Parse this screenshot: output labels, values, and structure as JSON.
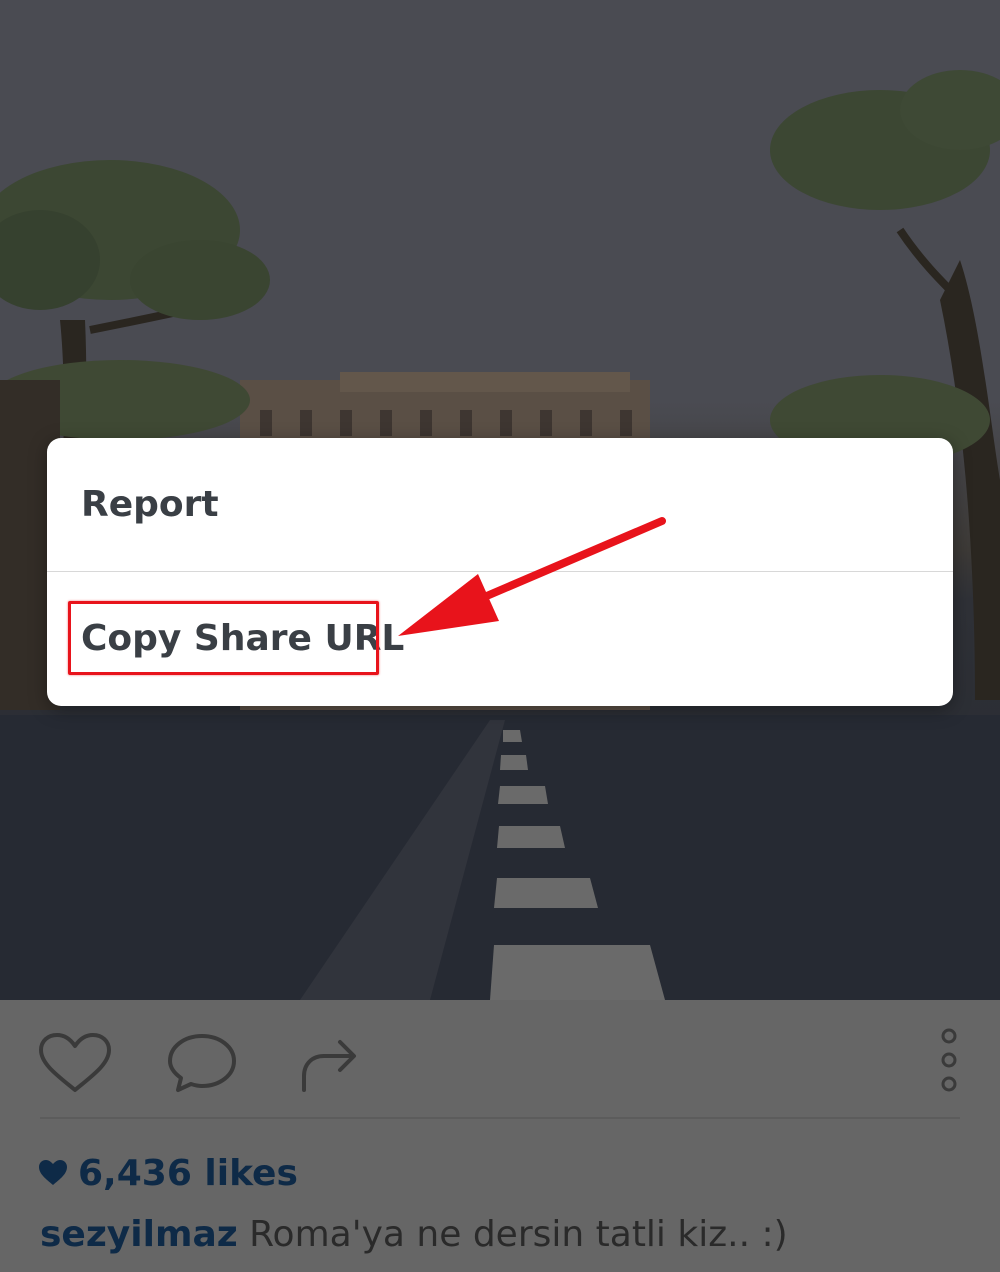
{
  "dialog": {
    "items": [
      {
        "label": "Report"
      },
      {
        "label": "Copy Share URL"
      }
    ]
  },
  "post": {
    "likes_text": "6,436 likes",
    "username": "sezyilmaz",
    "caption": "Roma'ya ne dersin tatli kiz.. :)"
  },
  "colors": {
    "highlight": "#e8131b",
    "overlay_dim": "#666666",
    "link_text": "#0e2a47"
  },
  "icons": [
    "heart-icon",
    "comment-icon",
    "share-icon",
    "more-options-icon",
    "red-arrow-annotation"
  ]
}
